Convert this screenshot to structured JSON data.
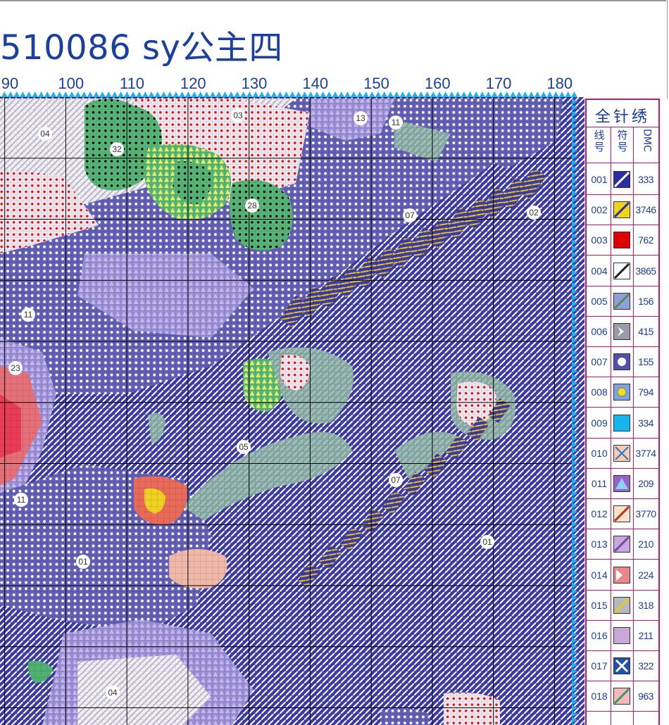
{
  "title": "510086 sy公主四",
  "ruler": {
    "labels": [
      "90",
      "100",
      "110",
      "120",
      "130",
      "140",
      "150",
      "160",
      "170",
      "180"
    ]
  },
  "legend": {
    "title": "全针绣",
    "headers": {
      "code": "线号",
      "symbol": "符号",
      "dmc": "DMC"
    },
    "rows": [
      {
        "code": "001",
        "dmc": "333",
        "color": "#2b2fa0",
        "symbol": "diag-white"
      },
      {
        "code": "002",
        "dmc": "3746",
        "color": "#f2d21a",
        "symbol": "diag-yellow"
      },
      {
        "code": "003",
        "dmc": "762",
        "color": "#e00000",
        "symbol": "dot"
      },
      {
        "code": "004",
        "dmc": "3865",
        "color": "#ffffff",
        "symbol": "diag-black"
      },
      {
        "code": "005",
        "dmc": "156",
        "color": "#8f9fd8",
        "symbol": "diag-green"
      },
      {
        "code": "006",
        "dmc": "415",
        "color": "#9a9aa8",
        "symbol": "chevron"
      },
      {
        "code": "007",
        "dmc": "155",
        "color": "#5050b0",
        "symbol": "circle"
      },
      {
        "code": "008",
        "dmc": "794",
        "color": "#7da4de",
        "symbol": "dot-yellow"
      },
      {
        "code": "009",
        "dmc": "334",
        "color": "#18b4ee",
        "symbol": "solid"
      },
      {
        "code": "010",
        "dmc": "3774",
        "color": "#f2cdb0",
        "symbol": "cross"
      },
      {
        "code": "011",
        "dmc": "209",
        "color": "#9a62c6",
        "symbol": "triangle"
      },
      {
        "code": "012",
        "dmc": "3770",
        "color": "#fbe2c8",
        "symbol": "diag-red"
      },
      {
        "code": "013",
        "dmc": "210",
        "color": "#c8a8e0",
        "symbol": "diag-purple"
      },
      {
        "code": "014",
        "dmc": "224",
        "color": "#e88888",
        "symbol": "arrow"
      },
      {
        "code": "015",
        "dmc": "318",
        "color": "#b8b8c0",
        "symbol": "diag-yellow2"
      },
      {
        "code": "016",
        "dmc": "211",
        "color": "#c8a8d8",
        "symbol": "solid"
      },
      {
        "code": "017",
        "dmc": "322",
        "color": "#2050a8",
        "symbol": "x-white"
      },
      {
        "code": "018",
        "dmc": "963",
        "color": "#f6b8c0",
        "symbol": "diag-green2"
      }
    ]
  },
  "marks": [
    "04",
    "03",
    "13",
    "11",
    "32",
    "28",
    "07",
    "02",
    "11",
    "23",
    "05",
    "07",
    "11",
    "01",
    "01",
    "04"
  ],
  "colors": {
    "title": "#1b3fa0",
    "legend_border": "#c2186b",
    "ruler_triangles": "#1fb0ee",
    "grid": "#000000"
  }
}
